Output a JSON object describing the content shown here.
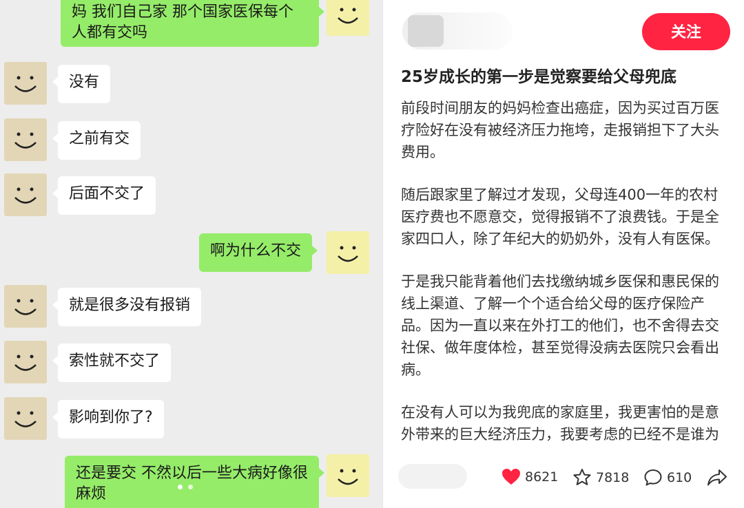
{
  "chat": {
    "messages": [
      {
        "from": "me",
        "text": "妈 我们自己家 那个国家医保每个人都有交吗"
      },
      {
        "from": "them",
        "text": "没有"
      },
      {
        "from": "them",
        "text": "之前有交"
      },
      {
        "from": "them",
        "text": "后面不交了"
      },
      {
        "from": "me",
        "text": "啊为什么不交"
      },
      {
        "from": "them",
        "text": "就是很多没有报销"
      },
      {
        "from": "them",
        "text": "索性就不交了"
      },
      {
        "from": "them",
        "text": "影响到你了?"
      },
      {
        "from": "me",
        "text": "还是要交 不然以后一些大病好像很麻烦"
      }
    ],
    "page_indicator": {
      "total": 2,
      "current": 1
    }
  },
  "post": {
    "follow_label": "关注",
    "title": "25岁成长的第一步是觉察要给父母兜底",
    "paragraphs": [
      "前段时间朋友的妈妈检查出癌症，因为买过百万医疗险好在没有被经济压力拖垮，走报销担下了大头费用。",
      "随后跟家里了解过才发现，父母连400一年的农村医疗费也不愿意交，觉得报销不了浪费钱。于是全家四口人，除了年纪大的奶奶外，没有人有医保。",
      "于是我只能背着他们去找缴纳城乡医保和惠民保的线上渠道、了解一个个适合给父母的医疗保险产品。因为一直以来在外打工的他们，也不舍得去交社保、做年度体检，甚至觉得没病去医院只会看出病。",
      "在没有人可以为我兜底的家庭里，我更害怕的是意外带来的巨大经济压力，我要考虑的已经不是谁为"
    ],
    "stats": {
      "likes": "8621",
      "collects": "7818",
      "comments": "610"
    },
    "colors": {
      "accent": "#ff2442",
      "like": "#ff2442",
      "me_bubble": "#95ec69"
    }
  }
}
